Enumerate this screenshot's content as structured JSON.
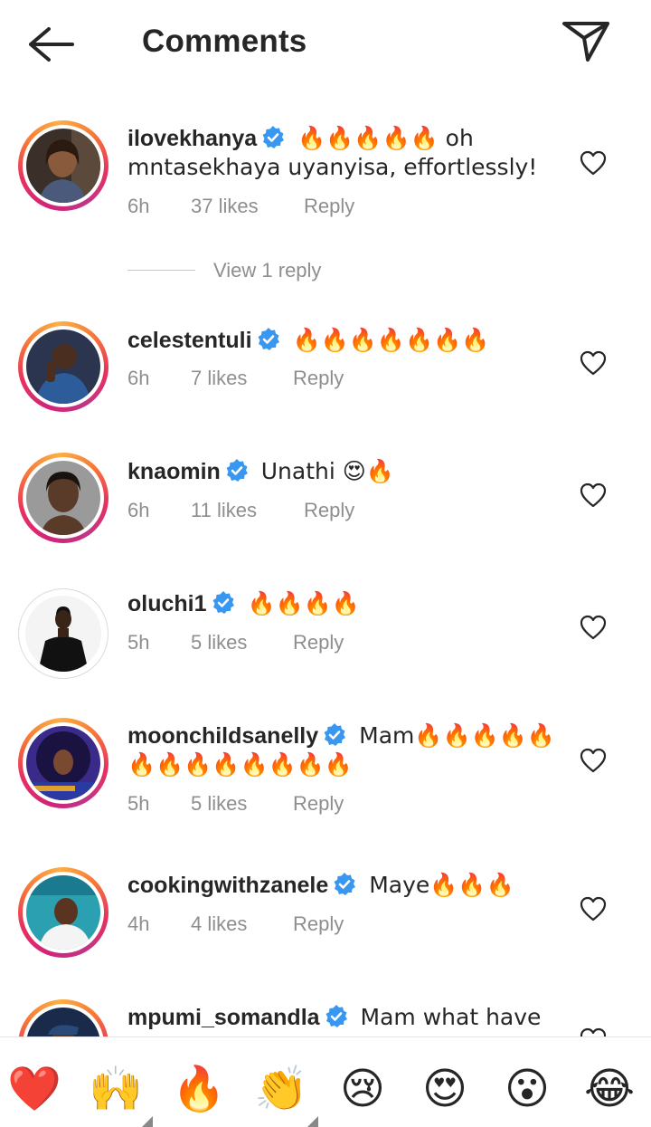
{
  "header": {
    "title": "Comments",
    "back_icon": "arrow-left-icon",
    "send_icon": "paper-plane-icon"
  },
  "colors": {
    "verified_blue": "#3897f0",
    "meta_gray": "#8e8e8e",
    "text": "#262626"
  },
  "comments": [
    {
      "username": "ilovekhanya",
      "text": "🔥🔥🔥🔥🔥 oh mntasekhaya uyanyisa, effortlessly!",
      "time": "6h",
      "likes": "37 likes",
      "reply": "Reply"
    },
    {
      "username": "celestentuli",
      "text": "🔥🔥🔥🔥🔥🔥🔥",
      "time": "6h",
      "likes": "7 likes",
      "reply": "Reply"
    },
    {
      "username": "knaomin",
      "text": "Unathi 😍🔥",
      "time": "6h",
      "likes": "11 likes",
      "reply": "Reply"
    },
    {
      "username": "oluchi1",
      "text": "🔥🔥🔥🔥",
      "time": "5h",
      "likes": "5 likes",
      "reply": "Reply"
    },
    {
      "username": "moonchildsanelly",
      "text": "Mam🔥🔥🔥🔥🔥🔥🔥🔥🔥🔥🔥🔥🔥",
      "time": "5h",
      "likes": "5 likes",
      "reply": "Reply"
    },
    {
      "username": "cookingwithzanele",
      "text": "Maye🔥🔥🔥",
      "time": "4h",
      "likes": "4 likes",
      "reply": "Reply"
    },
    {
      "username": "mpumi_somandla",
      "text": "Mam what have"
    }
  ],
  "view_replies": "View 1 reply",
  "emoji_bar": [
    {
      "emoji": "❤️",
      "name": "heart"
    },
    {
      "emoji": "🙌",
      "name": "raising-hands"
    },
    {
      "emoji": "🔥",
      "name": "fire"
    },
    {
      "emoji": "👏",
      "name": "clapping-hands"
    },
    {
      "emoji": "😢",
      "name": "crying-face"
    },
    {
      "emoji": "😍",
      "name": "heart-eyes"
    },
    {
      "emoji": "😮",
      "name": "open-mouth"
    },
    {
      "emoji": "😂",
      "name": "tears-of-joy"
    }
  ]
}
